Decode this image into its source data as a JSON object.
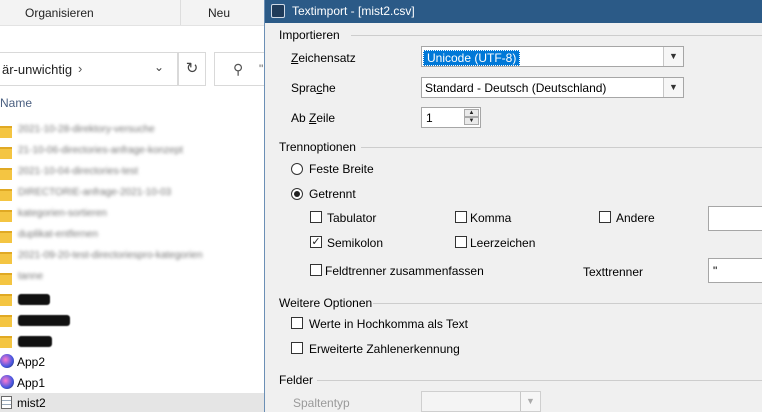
{
  "explorer": {
    "ribbon": {
      "organize": "Organisieren",
      "new": "Neu"
    },
    "address": {
      "path": "är-unwichtig",
      "refresh_icon": "refresh-icon",
      "search_placeholder": "\""
    },
    "column_name": "Name",
    "blurred_folders": [
      "2021-10-28-direktory-versuche",
      "21-10-06-directories-anfrage-konzept",
      "2021-10-04-directories-test",
      "DIRECTORIE-anfrage-2021-10-03",
      "kategorien-sortieren",
      "duplikat-entfernen",
      "2021-09-20-test-directoriespro-kategorien",
      "tanne"
    ],
    "files": [
      {
        "name": "App2",
        "icon": "app-icon"
      },
      {
        "name": "App1",
        "icon": "app-icon"
      },
      {
        "name": "mist2",
        "icon": "csv-file-icon"
      }
    ]
  },
  "dialog": {
    "title": "Textimport - [mist2.csv]",
    "import_section": "Importieren",
    "charset": {
      "label": "Zeichensatz",
      "value": "Unicode (UTF-8)"
    },
    "language": {
      "label": "Sprache",
      "value": "Standard - Deutsch (Deutschland)"
    },
    "from_row": {
      "label": "Ab Zeile",
      "value": "1"
    },
    "separator_section": "Trennoptionen",
    "fixed_width": "Feste Breite",
    "separated": "Getrennt",
    "tab": {
      "label": "Tabulator",
      "checked": false
    },
    "comma": {
      "label": "Komma",
      "checked": false
    },
    "other": {
      "label": "Andere",
      "checked": false
    },
    "semicolon": {
      "label": "Semikolon",
      "checked": true
    },
    "space": {
      "label": "Leerzeichen",
      "checked": false
    },
    "merge": {
      "label": "Feldtrenner zusammenfassen",
      "checked": false
    },
    "text_delim": {
      "label": "Texttrenner",
      "value": "\""
    },
    "further_section": "Weitere Optionen",
    "quoted_as_text": {
      "label": "Werte in Hochkomma als Text",
      "checked": false
    },
    "detect_numbers": {
      "label": "Erweiterte Zahlenerkennung",
      "checked": false
    },
    "fields_section": "Felder",
    "column_type": {
      "label": "Spaltentyp",
      "value": ""
    }
  }
}
